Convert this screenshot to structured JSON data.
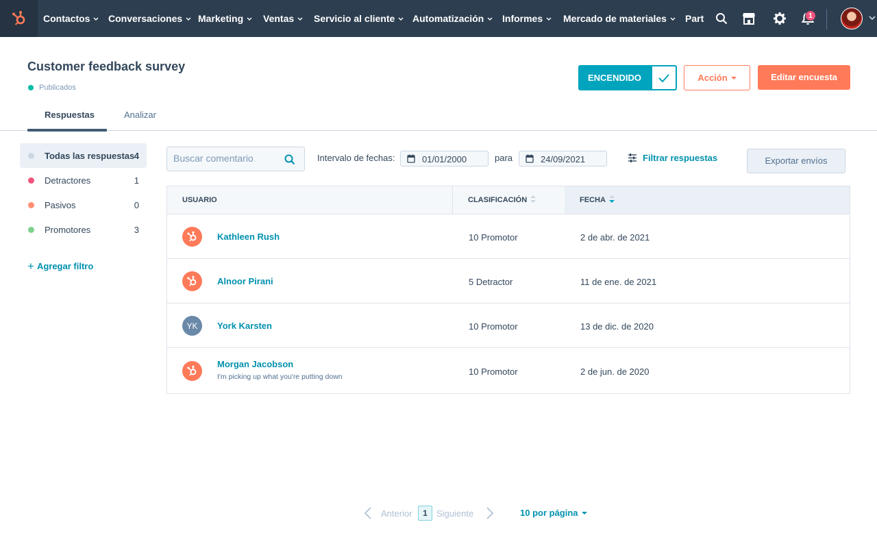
{
  "colors": {
    "nav_bg": "#2d3e50",
    "accent_teal": "#00a4bd",
    "accent_orange": "#ff7a59",
    "link": "#0091ae"
  },
  "topnav": {
    "logo": "hubspot-sprocket-icon",
    "items": [
      {
        "label": "Contactos"
      },
      {
        "label": "Conversaciones"
      },
      {
        "label": "Marketing"
      },
      {
        "label": "Ventas"
      },
      {
        "label": "Servicio al cliente"
      },
      {
        "label": "Automatización"
      },
      {
        "label": "Informes"
      },
      {
        "label": "Mercado de materiales"
      },
      {
        "label": "Part"
      }
    ],
    "icons": [
      "search-icon",
      "marketplace-icon",
      "gear-icon",
      "bell-icon"
    ],
    "notification_count": "1"
  },
  "header": {
    "title": "Customer feedback survey",
    "status": "Publicados",
    "toggle_label": "ENCENDIDO",
    "action_label": "Acción",
    "edit_label": "Editar encuesta"
  },
  "tabs": [
    {
      "label": "Respuestas",
      "active": true
    },
    {
      "label": "Analizar",
      "active": false
    }
  ],
  "filters": [
    {
      "label": "Todas las respuestas",
      "count": "4",
      "color": "#cbd6e2",
      "active": true
    },
    {
      "label": "Detractores",
      "count": "1",
      "color": "#f2547d",
      "active": false
    },
    {
      "label": "Pasivos",
      "count": "0",
      "color": "#ff8f73",
      "active": false
    },
    {
      "label": "Promotores",
      "count": "3",
      "color": "#7fd18e",
      "active": false
    }
  ],
  "add_filter_label": "Agregar filtro",
  "toolbar": {
    "search_placeholder": "Buscar comentario",
    "date_range_label": "Intervalo de fechas:",
    "date_from": "01/01/2000",
    "date_to_label": "para",
    "date_to": "24/09/2021",
    "filter_label": "Filtrar respuestas",
    "export_label": "Exportar envíos"
  },
  "table": {
    "columns": [
      "USUARIO",
      "CLASIFICACIÓN",
      "FECHA"
    ],
    "sort_column": "FECHA",
    "rows": [
      {
        "avatar": "hubspot-sprocket-icon",
        "initials": "",
        "name": "Kathleen Rush",
        "comment": "",
        "rating": "10 Promotor",
        "date": "2 de abr. de 2021"
      },
      {
        "avatar": "hubspot-sprocket-icon",
        "initials": "",
        "name": "Alnoor Pirani",
        "comment": "",
        "rating": "5 Detractor",
        "date": "11 de ene. de 2021"
      },
      {
        "avatar": "initials",
        "initials": "YK",
        "name": "York Karsten",
        "comment": "",
        "rating": "10 Promotor",
        "date": "13 de dic. de 2020"
      },
      {
        "avatar": "hubspot-sprocket-icon",
        "initials": "",
        "name": "Morgan Jacobson",
        "comment": "I'm picking up what you're putting down",
        "rating": "10 Promotor",
        "date": "2 de jun. de 2020"
      }
    ]
  },
  "pagination": {
    "prev_label": "Anterior",
    "current_page": "1",
    "next_label": "Siguiente",
    "per_page_label": "10 por página"
  }
}
